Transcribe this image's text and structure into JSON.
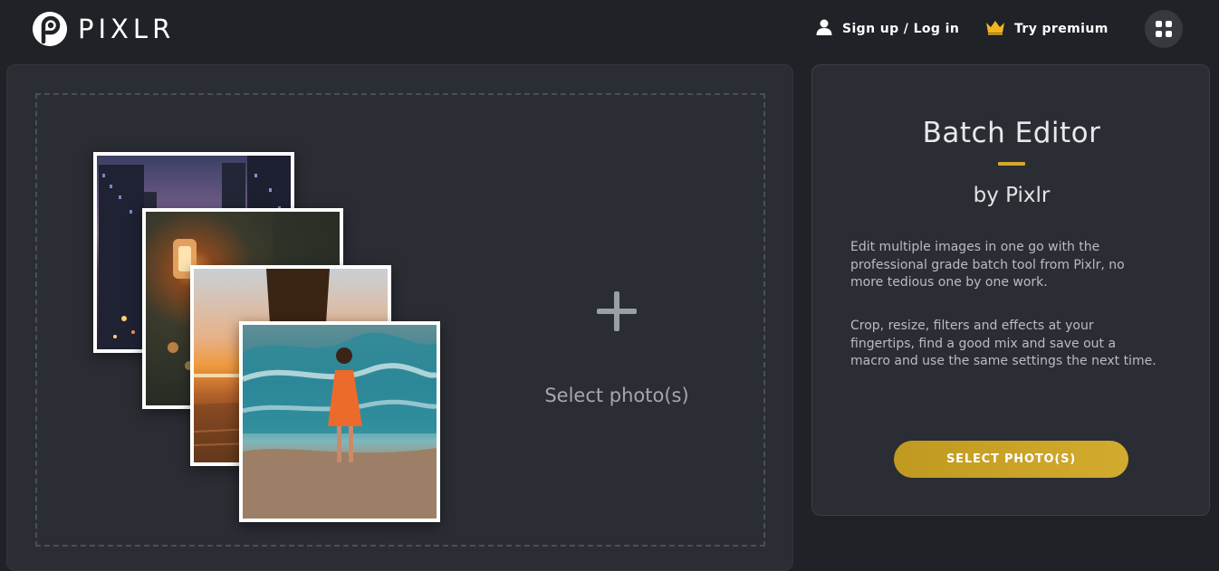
{
  "header": {
    "logo_text": "PIXLR",
    "signup_label": "Sign up / Log in",
    "premium_label": "Try premium"
  },
  "upload": {
    "select_label": "Select photo(s)"
  },
  "info": {
    "title": "Batch Editor",
    "subtitle": "by Pixlr",
    "paragraph_1": "Edit multiple images in one go with the professional grade batch tool from Pixlr, no more tedious one by one work.",
    "paragraph_2": "Crop, resize, filters and effects at your fingertips, find a good mix and save out a macro and use the same settings the next time.",
    "button_label": "SELECT PHOTO(S)"
  },
  "colors": {
    "background": "#1f2226",
    "panel": "#2a2d33",
    "accent": "#d4a82a"
  },
  "icons": [
    "pixlr-logo-icon",
    "user-icon",
    "crown-icon",
    "apps-grid-icon",
    "plus-icon"
  ]
}
